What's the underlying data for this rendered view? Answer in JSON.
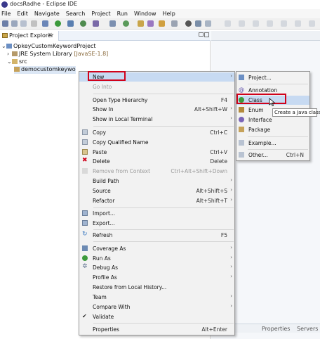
{
  "window": {
    "title": "docsRadhe - Eclipse IDE",
    "menu": [
      "File",
      "Edit",
      "Navigate",
      "Search",
      "Project",
      "Run",
      "Window",
      "Help"
    ]
  },
  "project_explorer": {
    "tab_label": "Project Explorer",
    "tab_close": "✕",
    "tree": {
      "project": "OpkeyCustomKeywordProject",
      "library": "JRE System Library",
      "library_suffix": "[JavaSE-1.8]",
      "src": "src",
      "package": "democustomkeywo"
    }
  },
  "context_menu": {
    "new": {
      "label": "New",
      "shortcut": "",
      "arrow": "›"
    },
    "go_into": {
      "label": "Go Into"
    },
    "open_type_hierarchy": {
      "label": "Open Type Hierarchy",
      "shortcut": "F4"
    },
    "show_in": {
      "label": "Show In",
      "shortcut": "Alt+Shift+W",
      "arrow": "›"
    },
    "show_in_terminal": {
      "label": "Show in Local Terminal",
      "arrow": "›"
    },
    "copy": {
      "label": "Copy",
      "shortcut": "Ctrl+C"
    },
    "copy_qualified": {
      "label": "Copy Qualified Name"
    },
    "paste": {
      "label": "Paste",
      "shortcut": "Ctrl+V"
    },
    "delete": {
      "label": "Delete",
      "shortcut": "Delete"
    },
    "remove_from_context": {
      "label": "Remove from Context",
      "shortcut": "Ctrl+Alt+Shift+Down"
    },
    "build_path": {
      "label": "Build Path",
      "arrow": "›"
    },
    "source": {
      "label": "Source",
      "shortcut": "Alt+Shift+S",
      "arrow": "›"
    },
    "refactor": {
      "label": "Refactor",
      "shortcut": "Alt+Shift+T",
      "arrow": "›"
    },
    "import": {
      "label": "Import..."
    },
    "export": {
      "label": "Export..."
    },
    "refresh": {
      "label": "Refresh",
      "shortcut": "F5"
    },
    "coverage_as": {
      "label": "Coverage As",
      "arrow": "›"
    },
    "run_as": {
      "label": "Run As",
      "arrow": "›"
    },
    "debug_as": {
      "label": "Debug As",
      "arrow": "›"
    },
    "profile_as": {
      "label": "Profile As",
      "arrow": "›"
    },
    "restore_history": {
      "label": "Restore from Local History..."
    },
    "team": {
      "label": "Team",
      "arrow": "›"
    },
    "compare_with": {
      "label": "Compare With",
      "arrow": "›"
    },
    "validate": {
      "label": "Validate"
    },
    "properties": {
      "label": "Properties",
      "shortcut": "Alt+Enter"
    }
  },
  "new_submenu": {
    "project": {
      "label": "Project..."
    },
    "annotation": {
      "label": "Annotation"
    },
    "class": {
      "label": "Class"
    },
    "enum": {
      "label": "Enum"
    },
    "interface": {
      "label": "Interface"
    },
    "package": {
      "label": "Package"
    },
    "example": {
      "label": "Example..."
    },
    "other": {
      "label": "Other...",
      "shortcut": "Ctrl+N"
    }
  },
  "tooltip": "Create a Java class",
  "bottom_tabs": [
    "Properties",
    "Servers"
  ],
  "colors": {
    "highlight_box": "#d0021b",
    "menu_hover": "#c7daf2",
    "menu_bg": "#f2f2f2"
  }
}
